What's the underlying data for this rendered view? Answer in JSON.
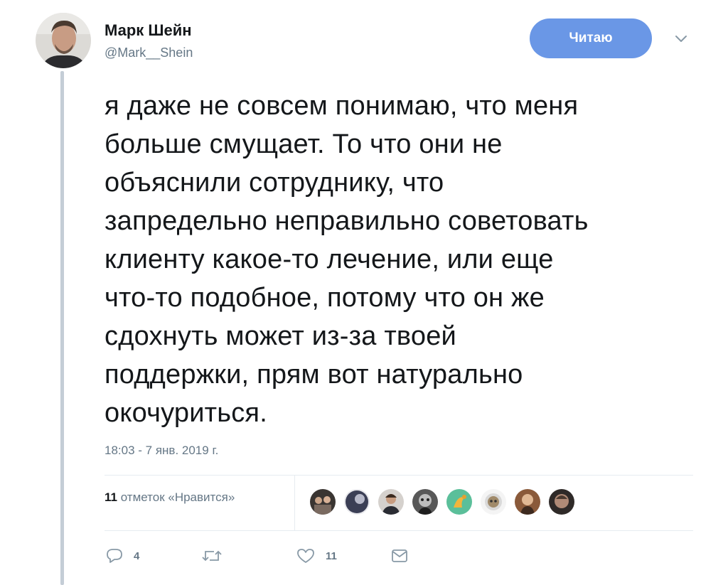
{
  "author": {
    "name": "Марк Шейн",
    "handle": "@Mark__Shein"
  },
  "follow_button": {
    "label": "Читаю",
    "color": "#6a97e6"
  },
  "tweet": {
    "lines": [
      "я даже не совсем понимаю, что меня",
      "больше смущает. То что они не",
      "объяснили сотруднику, что",
      "запредельно неправильно советовать",
      "клиенту какое-то лечение, или еще",
      "что-то подобное, потому что он же",
      "сдохнуть может из-за твоей",
      "поддержки, прям вот натурально",
      "окочуриться."
    ],
    "timestamp": "18:03 - 7 янв. 2019 г."
  },
  "likes": {
    "count": "11",
    "label": "отметок «Нравится»",
    "liker_avatars": [
      "avatar-1",
      "avatar-2",
      "avatar-3",
      "avatar-4",
      "avatar-5",
      "avatar-6",
      "avatar-7",
      "avatar-8"
    ]
  },
  "actions": {
    "reply_count": "4",
    "retweet_count": "",
    "like_count": "11"
  },
  "icons": [
    "reply-icon",
    "retweet-icon",
    "heart-icon",
    "message-icon",
    "chevron-down-icon"
  ]
}
